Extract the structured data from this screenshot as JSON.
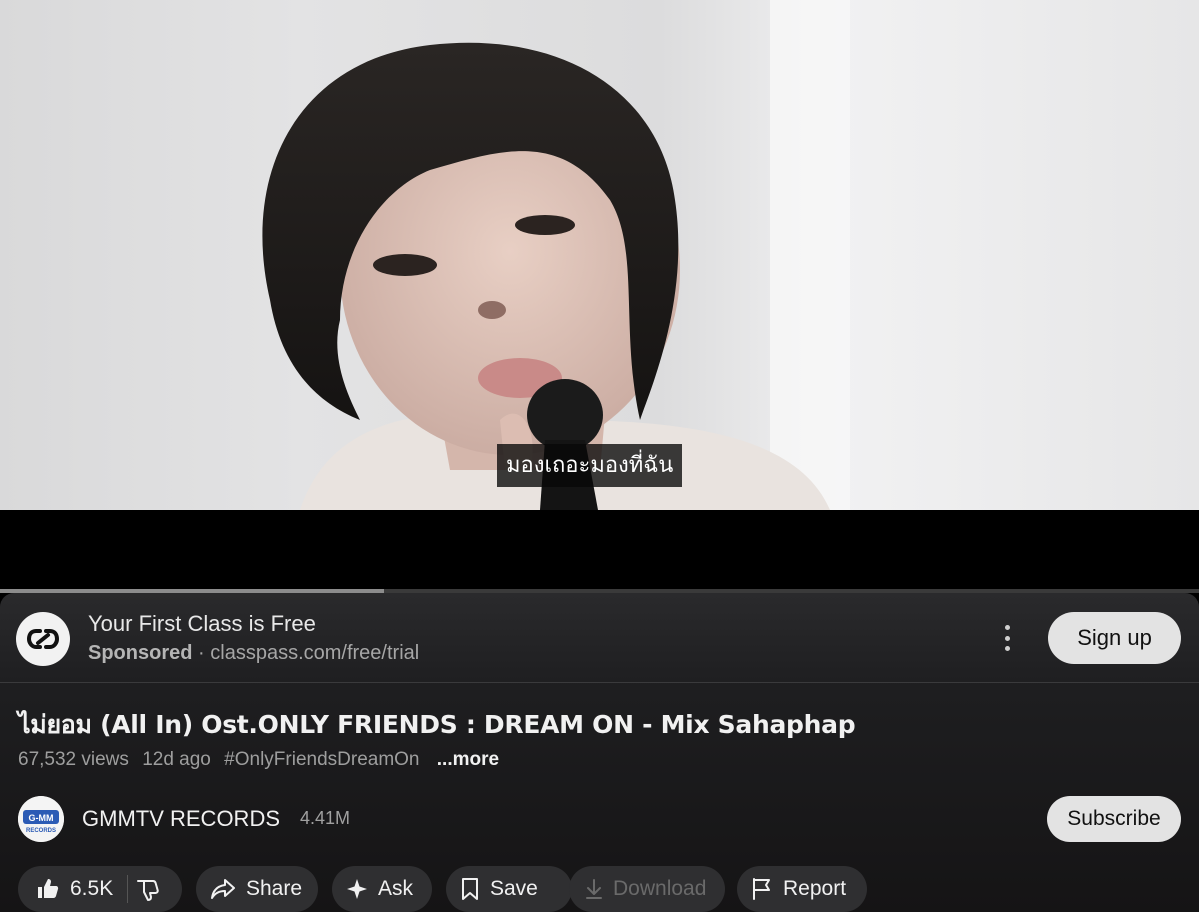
{
  "video": {
    "subtitle": "มองเถอะมองที่ฉัน",
    "progress_fraction": 0.32
  },
  "ad": {
    "title": "Your First Class is Free",
    "sponsored": "Sponsored",
    "separator": "·",
    "url": "classpass.com/free/trial",
    "cta": "Sign up",
    "logo_icon": "link-icon"
  },
  "video_info": {
    "title": "ไม่ยอม (All In) Ost.ONLY FRIENDS : DREAM ON - Mix Sahaphap",
    "views": "67,532 views",
    "age": "12d ago",
    "hashtag": "#OnlyFriendsDreamOn",
    "more": "...more"
  },
  "channel": {
    "name": "GMMTV RECORDS",
    "subscribers": "4.41M",
    "subscribe_label": "Subscribe",
    "avatar_text": "G-MM",
    "avatar_subtext": "RECORDS"
  },
  "actions": {
    "like_count": "6.5K",
    "share": "Share",
    "ask": "Ask",
    "save": "Save",
    "download": "Download",
    "report": "Report"
  },
  "colors": {
    "panel_bg": "#1e1e20",
    "pill_bg": "#2f2f31",
    "cta_bg": "#e3e3e3"
  }
}
